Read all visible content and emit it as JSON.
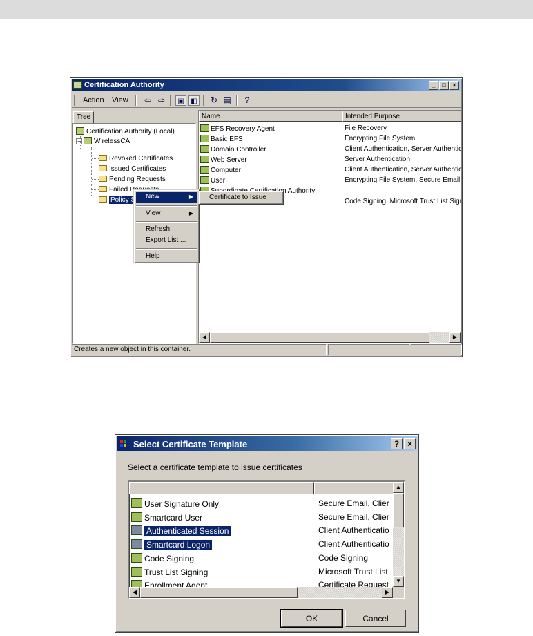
{
  "window1": {
    "title": "Certification Authority",
    "menu": {
      "action": "Action",
      "view": "View"
    },
    "tree_tab": "Tree",
    "tree": [
      "Certification Authority (Local)",
      "WirelessCA",
      "Revoked Certificates",
      "Issued Certificates",
      "Pending Requests",
      "Failed Requests",
      "Policy Settings"
    ],
    "columns": [
      "Name",
      "Intended Purpose"
    ],
    "rows": [
      {
        "name": "EFS Recovery Agent",
        "purpose": "File Recovery"
      },
      {
        "name": "Basic EFS",
        "purpose": "Encrypting File System"
      },
      {
        "name": "Domain Controller",
        "purpose": "Client Authentication, Server Authentic"
      },
      {
        "name": "Web Server",
        "purpose": "Server Authentication"
      },
      {
        "name": "Computer",
        "purpose": "Client Authentication, Server Authentic"
      },
      {
        "name": "User",
        "purpose": "Encrypting File System, Secure Email, C"
      },
      {
        "name": "Subordinate Certification Authority",
        "purpose": ""
      },
      {
        "name": "",
        "purpose": "Code Signing, Microsoft Trust List Signi"
      }
    ],
    "context_menu": {
      "new": "New",
      "view": "View",
      "refresh": "Refresh",
      "export": "Export List ...",
      "help": "Help"
    },
    "submenu": {
      "certificate_to_issue": "Certificate to Issue"
    },
    "status": "Creates a new object in this container."
  },
  "dialog": {
    "title": "Select Certificate Template",
    "prompt": "Select a certificate template to issue certificates",
    "rows": [
      {
        "name": "User Signature Only",
        "purpose": "Secure Email, Clier",
        "selected": false
      },
      {
        "name": "Smartcard User",
        "purpose": "Secure Email, Clier",
        "selected": false
      },
      {
        "name": "Authenticated Session",
        "purpose": "Client Authenticatio",
        "selected": true
      },
      {
        "name": "Smartcard Logon",
        "purpose": "Client Authenticatio",
        "selected": true
      },
      {
        "name": "Code Signing",
        "purpose": "Code Signing",
        "selected": false
      },
      {
        "name": "Trust List Signing",
        "purpose": "Microsoft Trust List",
        "selected": false
      },
      {
        "name": "Enrollment Agent",
        "purpose": "Certificate Request",
        "selected": false
      }
    ],
    "ok": "OK",
    "cancel": "Cancel"
  },
  "colors": {
    "selection": "#0a246a",
    "titlebar": "#0a246a",
    "face": "#d4d0c8"
  }
}
